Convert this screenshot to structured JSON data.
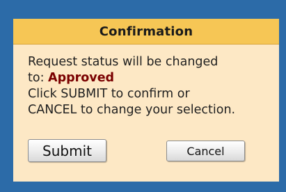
{
  "dialog": {
    "title": "Confirmation",
    "message_line1": "Request status will be changed",
    "message_prefix": "to: ",
    "status_value": "Approved",
    "message_line3": "Click SUBMIT to confirm or",
    "message_line4": "CANCEL to change your selection."
  },
  "buttons": {
    "submit_label": "Submit",
    "cancel_label": "Cancel"
  },
  "colors": {
    "frame": "#2c6ba8",
    "header": "#f6c655",
    "panel": "#fde8c5",
    "status_value": "#7a0000"
  }
}
